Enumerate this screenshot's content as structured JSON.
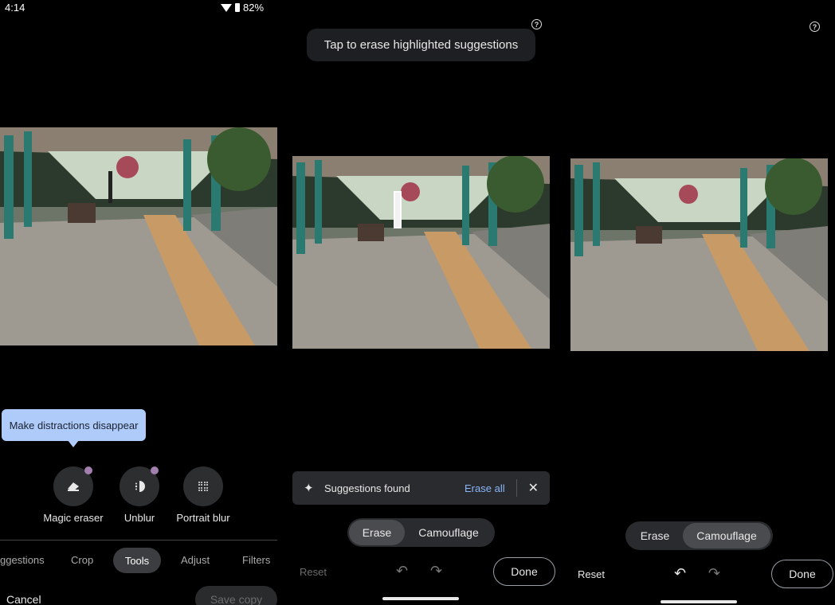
{
  "status": {
    "time": "4:14",
    "battery": "82%"
  },
  "left": {
    "tooltip": "Make distractions disappear",
    "tools": [
      {
        "label": "Magic eraser",
        "icon": "eraser-icon"
      },
      {
        "label": "Unblur",
        "icon": "unblur-icon"
      },
      {
        "label": "Portrait blur",
        "icon": "portrait-blur-icon"
      }
    ],
    "tabs": [
      "ggestions",
      "Crop",
      "Tools",
      "Adjust",
      "Filters"
    ],
    "active_tab": "Tools",
    "cancel": "Cancel",
    "save_copy": "Save copy"
  },
  "middle": {
    "toast": "Tap to erase highlighted suggestions",
    "suggestions_text": "Suggestions found",
    "erase_all": "Erase all",
    "seg_erase": "Erase",
    "seg_camouflage": "Camouflage",
    "reset": "Reset",
    "done": "Done"
  },
  "right": {
    "seg_erase": "Erase",
    "seg_camouflage": "Camouflage",
    "reset": "Reset",
    "done": "Done"
  },
  "colors": {
    "accent_link": "#8ab4f8",
    "tooltip_bg": "#aecbfa",
    "badge_dot": "#a37fb0"
  }
}
